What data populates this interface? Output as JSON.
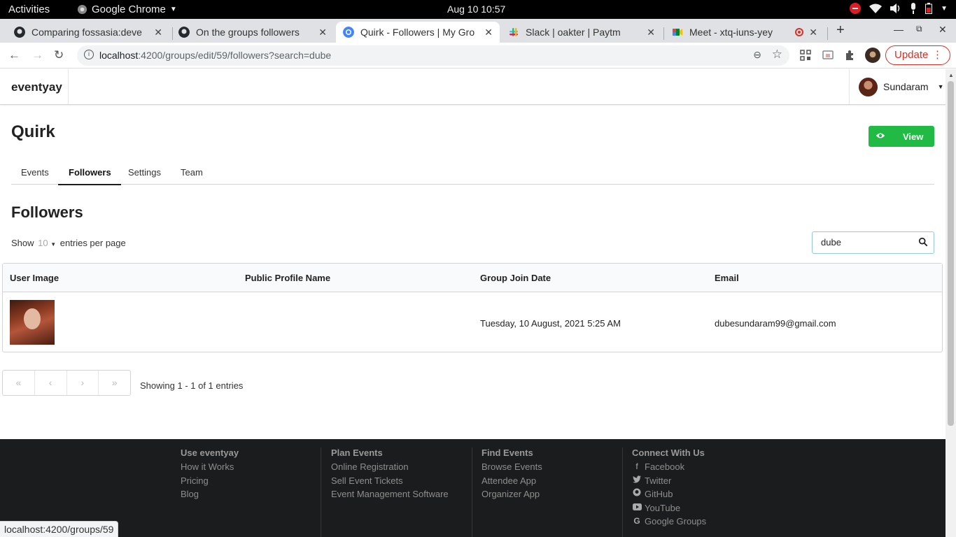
{
  "system_bar": {
    "activities": "Activities",
    "app_name": "Google Chrome",
    "clock": "Aug 10  10:57"
  },
  "browser": {
    "tabs": [
      {
        "title": "Comparing fossasia:deve",
        "favicon": "github-icon"
      },
      {
        "title": "On the groups followers",
        "favicon": "github-icon"
      },
      {
        "title": "Quirk - Followers | My Gro",
        "favicon": "chromium-icon",
        "active": true
      },
      {
        "title": "Slack | oakter | Paytm",
        "favicon": "slack-icon"
      },
      {
        "title": "Meet - xtq-iuns-yey",
        "favicon": "meet-icon"
      }
    ],
    "url_host": "localhost",
    "url_rest": ":4200/groups/edit/59/followers?search=dube",
    "update_label": "Update",
    "status_url": "localhost:4200/groups/59"
  },
  "header": {
    "brand": "eventyay",
    "user_name": "Sundaram"
  },
  "group": {
    "title": "Quirk",
    "view_label": "View"
  },
  "tabs": [
    {
      "label": "Events"
    },
    {
      "label": "Followers",
      "active": true
    },
    {
      "label": "Settings"
    },
    {
      "label": "Team"
    }
  ],
  "followers": {
    "title": "Followers",
    "show_label": "Show",
    "per_page": "10",
    "entries_label": "entries per page",
    "search_value": "dube",
    "columns": [
      "User Image",
      "Public Profile Name",
      "Group Join Date",
      "Email"
    ],
    "rows": [
      {
        "public_profile_name": "",
        "join_date": "Tuesday, 10 August, 2021 5:25 AM",
        "email": "dubesundaram99@gmail.com"
      }
    ],
    "pager": [
      "«",
      "‹",
      "›",
      "»"
    ],
    "showing": "Showing 1 - 1 of 1 entries"
  },
  "footer": {
    "columns": [
      {
        "heading": "Use eventyay",
        "links": [
          "How it Works",
          "Pricing",
          "Blog"
        ]
      },
      {
        "heading": "Plan Events",
        "links": [
          "Online Registration",
          "Sell Event Tickets",
          "Event Management Software"
        ]
      },
      {
        "heading": "Find Events",
        "links": [
          "Browse Events",
          "Attendee App",
          "Organizer App"
        ]
      },
      {
        "heading": "Connect With Us",
        "links": [
          {
            "label": "Facebook",
            "icon": "facebook-icon"
          },
          {
            "label": "Twitter",
            "icon": "twitter-icon"
          },
          {
            "label": "GitHub",
            "icon": "github-icon"
          },
          {
            "label": "YouTube",
            "icon": "youtube-icon"
          },
          {
            "label": "Google Groups",
            "icon": "google-icon"
          }
        ]
      }
    ]
  },
  "colors": {
    "primary_green": "#21ba45",
    "footer_bg": "#1b1c1d",
    "update_red": "#d93025"
  }
}
